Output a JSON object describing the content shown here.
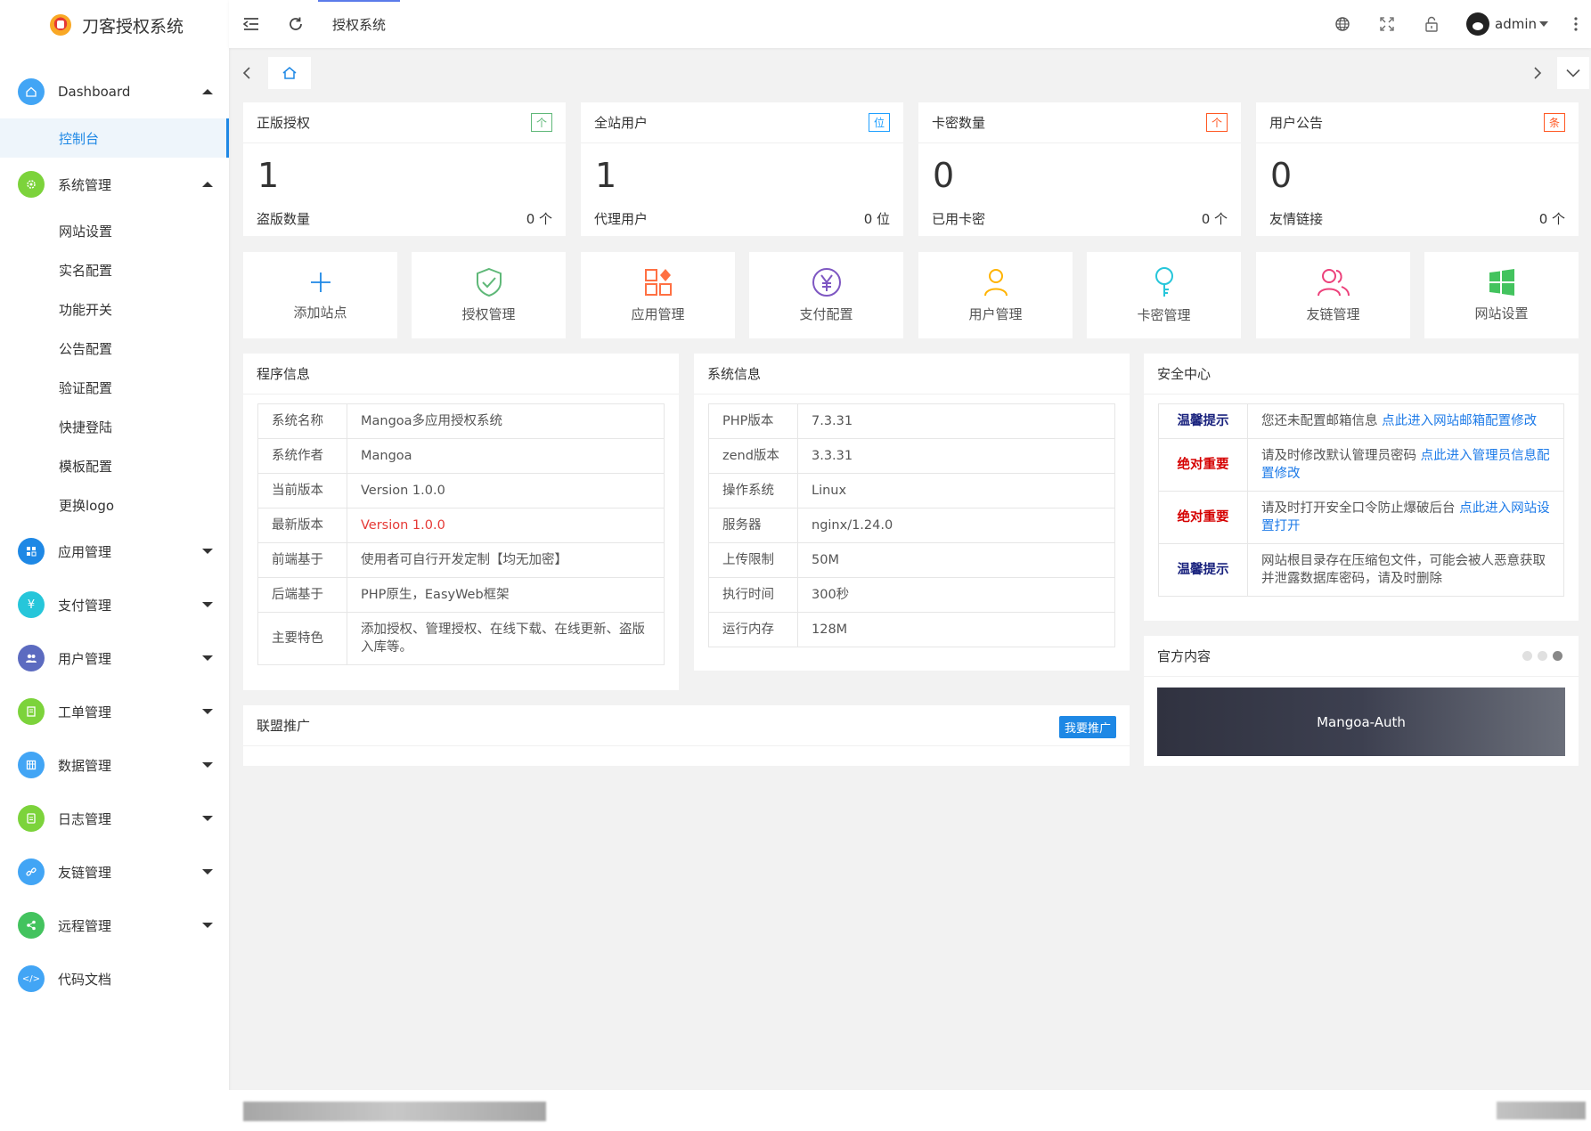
{
  "app": {
    "title": "刀客授权系统"
  },
  "topbar": {
    "page_tab": "授权系统",
    "username": "admin"
  },
  "sidebar": {
    "dashboard": {
      "label": "Dashboard",
      "sub": [
        {
          "label": "控制台"
        }
      ]
    },
    "system": {
      "label": "系统管理",
      "sub": [
        {
          "label": "网站设置"
        },
        {
          "label": "实名配置"
        },
        {
          "label": "功能开关"
        },
        {
          "label": "公告配置"
        },
        {
          "label": "验证配置"
        },
        {
          "label": "快捷登陆"
        },
        {
          "label": "模板配置"
        },
        {
          "label": "更换logo"
        }
      ]
    },
    "groups": [
      {
        "label": "应用管理",
        "color": "#1e88e5"
      },
      {
        "label": "支付管理",
        "color": "#26c6da"
      },
      {
        "label": "用户管理",
        "color": "#5c6bc0"
      },
      {
        "label": "工单管理",
        "color": "#7cd33b"
      },
      {
        "label": "数据管理",
        "color": "#42a5f5"
      },
      {
        "label": "日志管理",
        "color": "#7cd33b"
      },
      {
        "label": "友链管理",
        "color": "#42a5f5"
      },
      {
        "label": "远程管理",
        "color": "#43c35e"
      },
      {
        "label": "代码文档",
        "color": "#42a5f5"
      }
    ]
  },
  "stats": [
    {
      "title": "正版授权",
      "badge": "个",
      "badge_color": "#5fb878",
      "value": "1",
      "foot_label": "盗版数量",
      "foot_value": "0 个"
    },
    {
      "title": "全站用户",
      "badge": "位",
      "badge_color": "#1e9fff",
      "value": "1",
      "foot_label": "代理用户",
      "foot_value": "0 位"
    },
    {
      "title": "卡密数量",
      "badge": "个",
      "badge_color": "#ff5722",
      "value": "0",
      "foot_label": "已用卡密",
      "foot_value": "0 个"
    },
    {
      "title": "用户公告",
      "badge": "条",
      "badge_color": "#ff5722",
      "value": "0",
      "foot_label": "友情链接",
      "foot_value": "0 个"
    }
  ],
  "quick": [
    {
      "label": "添加站点",
      "icon": "plus-icon",
      "color": "#1e88e5"
    },
    {
      "label": "授权管理",
      "icon": "shield-check-icon",
      "color": "#5fb878"
    },
    {
      "label": "应用管理",
      "icon": "apps-icon",
      "color": "#ff7043"
    },
    {
      "label": "支付配置",
      "icon": "yen-icon",
      "color": "#7e57c2"
    },
    {
      "label": "用户管理",
      "icon": "user-icon",
      "color": "#ffb300"
    },
    {
      "label": "卡密管理",
      "icon": "key-icon",
      "color": "#26c6da"
    },
    {
      "label": "友链管理",
      "icon": "users-icon",
      "color": "#ec407a"
    },
    {
      "label": "网站设置",
      "icon": "windows-icon",
      "color": "#43c35e"
    }
  ],
  "program": {
    "title": "程序信息",
    "rows": [
      {
        "k": "系统名称",
        "v": "Mangoa多应用授权系统"
      },
      {
        "k": "系统作者",
        "v": "Mangoa"
      },
      {
        "k": "当前版本",
        "v": "Version 1.0.0"
      },
      {
        "k": "最新版本",
        "v": "Version 1.0.0",
        "color": "#e53935"
      },
      {
        "k": "前端基于",
        "v": "使用者可自行开发定制【均无加密】"
      },
      {
        "k": "后端基于",
        "v": "PHP原生，EasyWeb框架"
      },
      {
        "k": "主要特色",
        "v": "添加授权、管理授权、在线下载、在线更新、盗版入库等。"
      }
    ]
  },
  "system": {
    "title": "系统信息",
    "rows": [
      {
        "k": "PHP版本",
        "v": "7.3.31"
      },
      {
        "k": "zend版本",
        "v": "3.3.31"
      },
      {
        "k": "操作系统",
        "v": "Linux"
      },
      {
        "k": "服务器",
        "v": "nginx/1.24.0"
      },
      {
        "k": "上传限制",
        "v": "50M"
      },
      {
        "k": "执行时间",
        "v": "300秒"
      },
      {
        "k": "运行内存",
        "v": "128M"
      }
    ]
  },
  "security": {
    "title": "安全中心",
    "rows": [
      {
        "k": "温馨提示",
        "k_color": "#1a237e",
        "text": "您还未配置邮箱信息 ",
        "link": "点此进入网站邮箱配置修改"
      },
      {
        "k": "绝对重要",
        "k_color": "#d50000",
        "text": "请及时修改默认管理员密码 ",
        "link": "点此进入管理员信息配置修改"
      },
      {
        "k": "绝对重要",
        "k_color": "#d50000",
        "text": "请及时打开安全口令防止爆破后台 ",
        "link": "点此进入网站设置打开"
      },
      {
        "k": "温馨提示",
        "k_color": "#1a237e",
        "text": "网站根目录存在压缩包文件，可能会被人恶意获取并泄露数据库密码，请及时删除",
        "link": ""
      }
    ]
  },
  "official": {
    "title": "官方内容",
    "banner": "Mangoa-Auth"
  },
  "alliance": {
    "title": "联盟推广",
    "button": "我要推广"
  }
}
